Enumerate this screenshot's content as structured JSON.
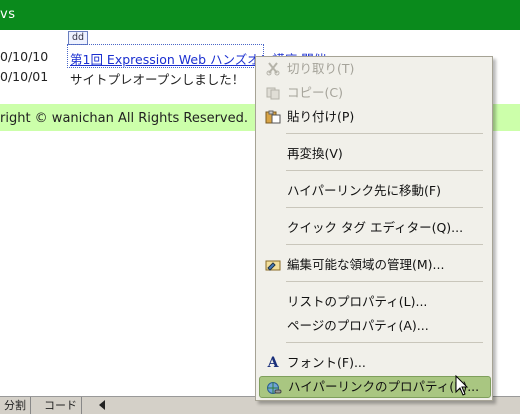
{
  "page": {
    "news_title": "vs",
    "dd_tag": "dd",
    "rows": [
      {
        "date": "0/10/10",
        "text": "第1回 Expression Web ハンズオン講座 開催"
      },
      {
        "date": "0/10/01",
        "text": "サイトプレオープンしました！"
      }
    ],
    "footer": "right © wanichan All Rights Reserved."
  },
  "bottom_bar": {
    "tab_split": "分割",
    "tab_code": "コード"
  },
  "context_menu": {
    "items": [
      {
        "label": "切り取り(T)",
        "icon": "scissors-icon",
        "disabled": true
      },
      {
        "label": "コピー(C)",
        "icon": "copy-icon",
        "disabled": true
      },
      {
        "label": "貼り付け(P)",
        "icon": "paste-icon",
        "disabled": false
      },
      {
        "label": "再変換(V)",
        "icon": "",
        "disabled": false
      },
      {
        "label": "ハイパーリンク先に移動(F)",
        "icon": "",
        "disabled": false
      },
      {
        "label": "クイック タグ エディター(Q)...",
        "icon": "",
        "disabled": false
      },
      {
        "label": "編集可能な領域の管理(M)...",
        "icon": "editable-region-icon",
        "disabled": false
      },
      {
        "label": "リストのプロパティ(L)...",
        "icon": "",
        "disabled": false
      },
      {
        "label": "ページのプロパティ(A)...",
        "icon": "",
        "disabled": false
      },
      {
        "label": "フォント(F)...",
        "icon": "font-icon",
        "disabled": false
      },
      {
        "label": "ハイパーリンクのプロパティ(K)...",
        "icon": "hyperlink-properties-icon",
        "disabled": false,
        "highlighted": true
      }
    ]
  },
  "colors": {
    "header_green": "#0a8a1c",
    "footer_green": "#ccffaa",
    "menu_highlight": "#a9c681",
    "link_blue": "#1a2fd0"
  }
}
